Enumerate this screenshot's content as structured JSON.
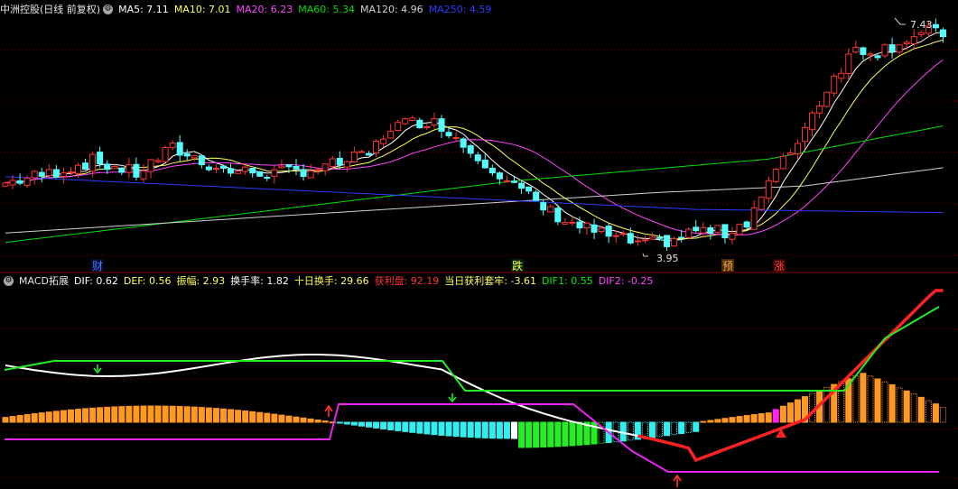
{
  "colors": {
    "bg": "#000000",
    "up": "#ff3232",
    "down": "#54ffff",
    "grid": "#7a0000",
    "ma5": "#ffffff",
    "ma10": "#ffff55",
    "ma20": "#ff44ff",
    "ma60": "#00dd00",
    "ma120": "#d0d0d0",
    "ma250": "#2b3bff",
    "white": "#ffffff"
  },
  "header1": {
    "title": "中洲控股(日线 前复权)",
    "gear_icon": "gear-icon",
    "items": [
      {
        "label": "MA5: 7.11",
        "color": "#ffffff"
      },
      {
        "label": "MA10: 7.01",
        "color": "#ffff55"
      },
      {
        "label": "MA20: 6.23",
        "color": "#ff44ff"
      },
      {
        "label": "MA60: 5.34",
        "color": "#00dd00"
      },
      {
        "label": "MA120: 4.96",
        "color": "#d0d0d0"
      },
      {
        "label": "MA250: 4.59",
        "color": "#2b3bff"
      }
    ]
  },
  "header2": {
    "title": "MACD拓展",
    "gear_icon": "gear-icon",
    "items": [
      {
        "label": "DIF: 0.62",
        "color": "#ffffff"
      },
      {
        "label": "DEF: 0.56",
        "color": "#ffff55"
      },
      {
        "label": "振幅: 2.93",
        "color": "#ffff55"
      },
      {
        "label": "换手率: 1.82",
        "color": "#ffffff"
      },
      {
        "label": "十日换手: 29.66",
        "color": "#ffff55"
      },
      {
        "label": "获利盘: 92.19",
        "color": "#ff3232"
      },
      {
        "label": "当日获利套牢: -3.61",
        "color": "#ffff55"
      },
      {
        "label": "DIF1: 0.55",
        "color": "#00ee00"
      },
      {
        "label": "DIF2: -0.25",
        "color": "#ff44ff"
      }
    ]
  },
  "chart_data": [
    {
      "type": "candlestick",
      "annotations": [
        {
          "text": "7.43",
          "kind": "max"
        },
        {
          "text": "3.95",
          "kind": "min"
        }
      ],
      "event_labels": [
        "财",
        "跌",
        "预",
        "涨"
      ]
    },
    {
      "type": "bar",
      "markers": {
        "down_arrows": 2,
        "up_arrows": 2,
        "triangles": 1
      }
    }
  ]
}
